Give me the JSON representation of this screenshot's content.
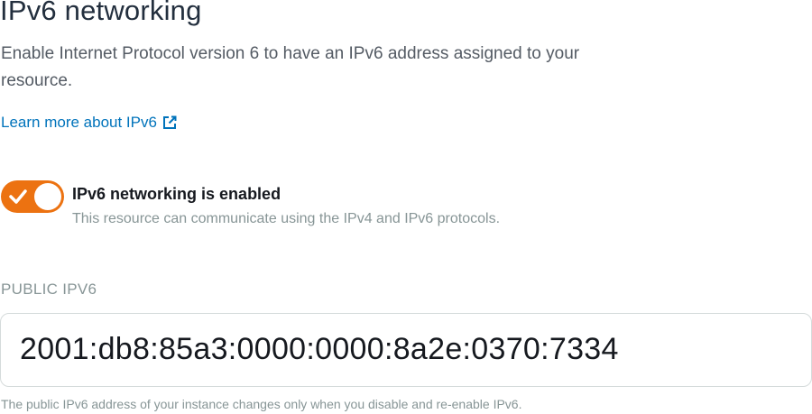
{
  "section": {
    "title": "IPv6 networking",
    "description": "Enable Internet Protocol version 6 to have an IPv6 address assigned to your resource.",
    "learn_more_link": "Learn more about IPv6",
    "learn_more_icon": "external-link-icon"
  },
  "toggle": {
    "state": "on",
    "checked": true,
    "label": "IPv6 networking is enabled",
    "description": "This resource can communicate using the IPv4 and IPv6 protocols.",
    "accent_color": "#ec7211"
  },
  "public_ipv6": {
    "label": "PUBLIC IPV6",
    "value": "2001:db8:85a3:0000:0000:8a2e:0370:7334",
    "helper_text": "The public IPv6 address of your instance changes only when you disable and re-enable IPv6."
  }
}
